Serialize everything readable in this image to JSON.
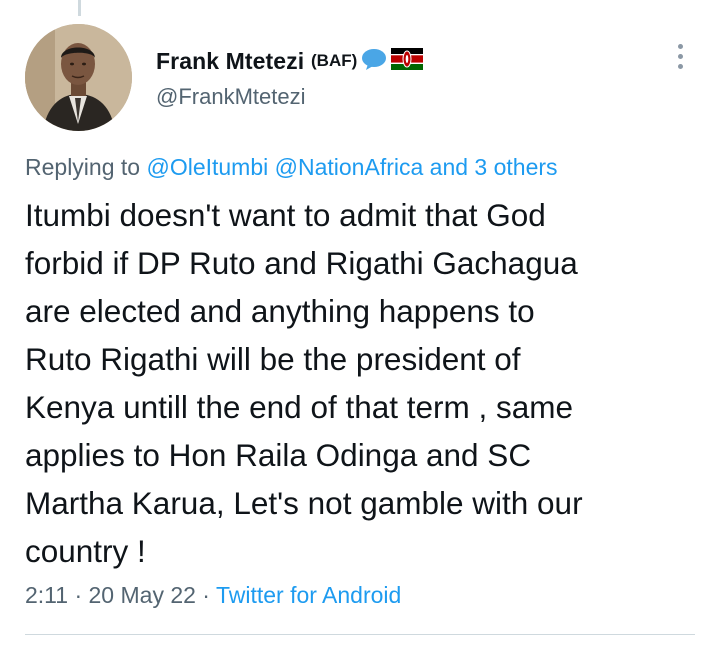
{
  "author": {
    "display_name": "Frank Mtetezi",
    "name_suffix": "(BAF)",
    "emoji_icons": [
      "speech-bubble-icon",
      "kenya-flag-icon"
    ],
    "handle": "@FrankMtetezi"
  },
  "reply_context": {
    "prefix": "Replying to",
    "mentions": [
      "@OleItumbi",
      "@NationAfrica"
    ],
    "others_text": "and 3 others"
  },
  "tweet": {
    "text": "Itumbi doesn't want to admit that God\nforbid if DP Ruto and Rigathi Gachagua\nare elected  and anything happens to\nRuto Rigathi will be the president of\nKenya untill the end of that term , same\napplies to Hon Raila Odinga and  SC\nMartha Karua, Let's not gamble with our\ncountry !"
  },
  "meta": {
    "time": "2:11",
    "separator": " · ",
    "date": "20 May 22",
    "source": "Twitter for Android"
  },
  "colors": {
    "text": "#0f1419",
    "secondary": "#536471",
    "link": "#1d9bf0",
    "divider": "#cfd9de"
  }
}
